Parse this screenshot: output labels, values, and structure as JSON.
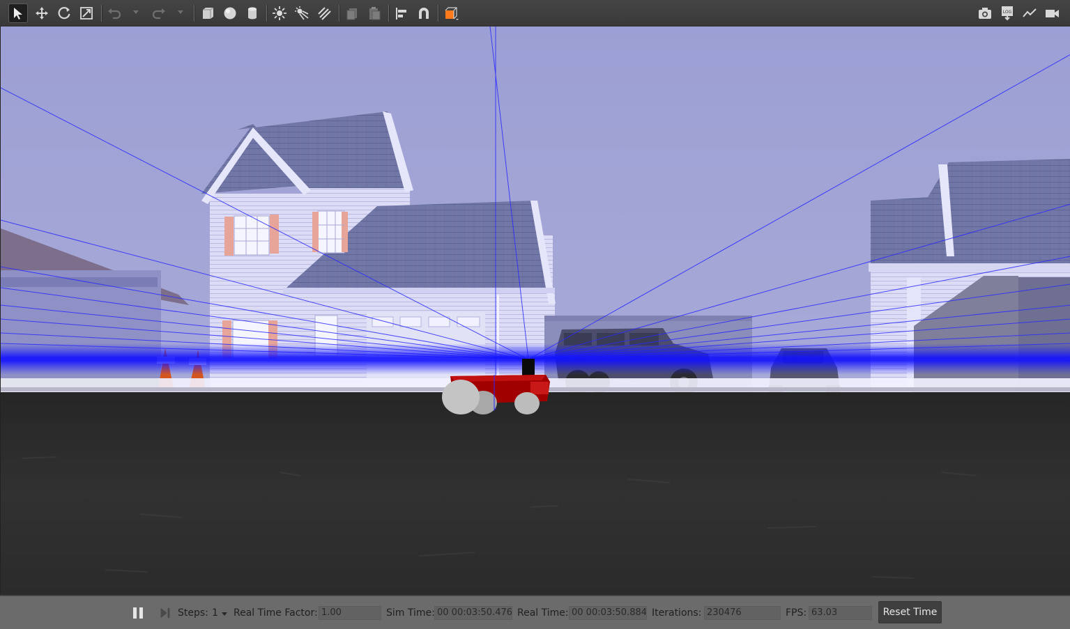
{
  "toolbar": {
    "left_tools": [
      {
        "name": "select-mode",
        "icon": "arrow-cursor-icon",
        "active": true
      },
      {
        "name": "translate-mode",
        "icon": "move-arrows-icon"
      },
      {
        "name": "rotate-mode",
        "icon": "rotate-icon"
      },
      {
        "name": "scale-mode",
        "icon": "scale-icon"
      },
      {
        "name": "undo",
        "icon": "undo-icon"
      },
      {
        "name": "redo",
        "icon": "redo-icon"
      },
      {
        "name": "box-shape",
        "icon": "box-icon"
      },
      {
        "name": "sphere-shape",
        "icon": "sphere-icon"
      },
      {
        "name": "cylinder-shape",
        "icon": "cylinder-icon"
      },
      {
        "name": "point-light",
        "icon": "point-light-icon"
      },
      {
        "name": "spot-light",
        "icon": "spot-light-icon"
      },
      {
        "name": "directional-light",
        "icon": "directional-light-icon"
      },
      {
        "name": "copy",
        "icon": "copy-icon"
      },
      {
        "name": "paste",
        "icon": "paste-icon"
      },
      {
        "name": "align",
        "icon": "align-icon"
      },
      {
        "name": "snap",
        "icon": "magnet-icon"
      },
      {
        "name": "view-angle",
        "icon": "orange-cube-icon"
      }
    ],
    "right_tools": [
      {
        "name": "screenshot",
        "icon": "camera-icon"
      },
      {
        "name": "log",
        "icon": "log-icon",
        "text": "LOG"
      },
      {
        "name": "plot",
        "icon": "plot-icon"
      },
      {
        "name": "record-video",
        "icon": "video-camera-icon"
      }
    ]
  },
  "viewport": {
    "sky_color": "#a0a2d4",
    "ground_color": "#2e2e2e",
    "laser_color": "#1010ff",
    "robot_body_color": "#a50000"
  },
  "statusbar": {
    "pause_icon": "pause-icon",
    "step_icon": "step-forward-icon",
    "steps_label": "Steps:",
    "steps_value": "1",
    "rtf_label": "Real Time Factor:",
    "rtf_value": "1.00",
    "sim_time_label": "Sim Time:",
    "sim_time_value": "00 00:03:50.476",
    "real_time_label": "Real Time:",
    "real_time_value": "00 00:03:50.884",
    "iterations_label": "Iterations:",
    "iterations_value": "230476",
    "fps_label": "FPS:",
    "fps_value": "63.03",
    "reset_label": "Reset Time"
  }
}
